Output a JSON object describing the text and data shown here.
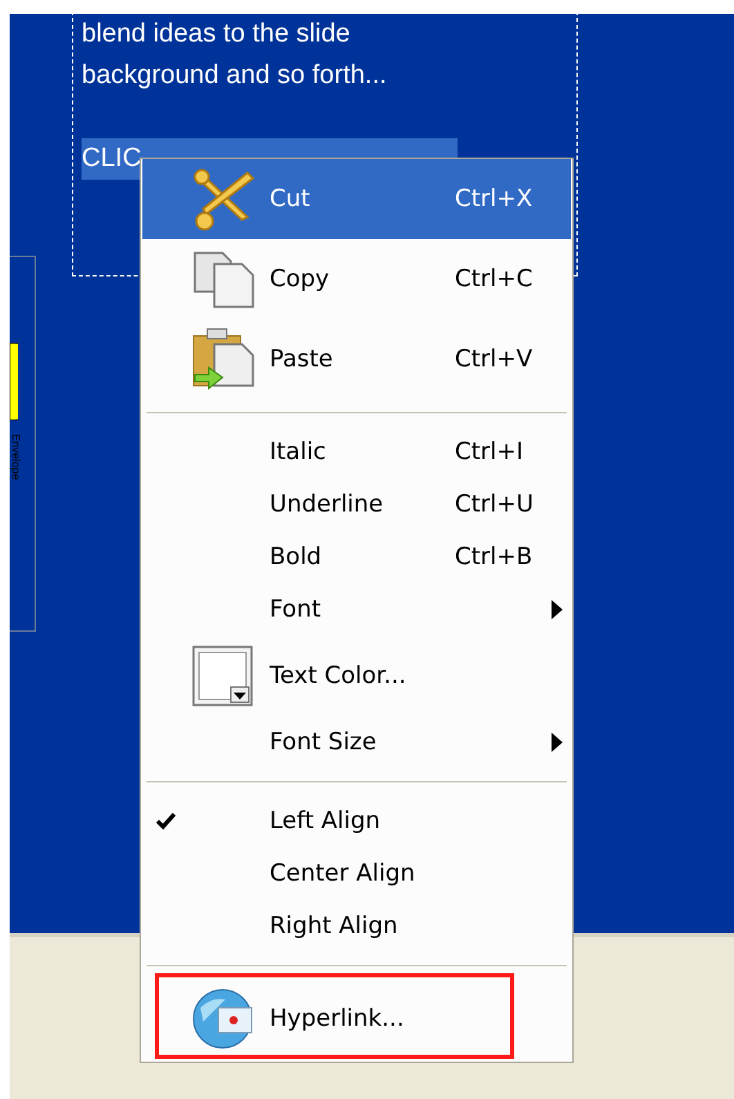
{
  "slide": {
    "text_lines": [
      "blend ideas to the slide",
      "background and so forth..."
    ],
    "selected_text": "CLIC",
    "side_label": "Envelope"
  },
  "context_menu": {
    "items": [
      {
        "kind": "item",
        "label": "Cut",
        "shortcut": "Ctrl+X",
        "selected": true,
        "checked": false,
        "submenu": false,
        "outlined": false
      },
      {
        "kind": "item",
        "label": "Copy",
        "shortcut": "Ctrl+C",
        "selected": false,
        "checked": false,
        "submenu": false,
        "outlined": false
      },
      {
        "kind": "item",
        "label": "Paste",
        "shortcut": "Ctrl+V",
        "selected": false,
        "checked": false,
        "submenu": false,
        "outlined": false
      },
      {
        "kind": "separator"
      },
      {
        "kind": "item",
        "label": "Italic",
        "shortcut": "Ctrl+I",
        "selected": false,
        "checked": false,
        "submenu": false,
        "outlined": false
      },
      {
        "kind": "item",
        "label": "Underline",
        "shortcut": "Ctrl+U",
        "selected": false,
        "checked": false,
        "submenu": false,
        "outlined": false
      },
      {
        "kind": "item",
        "label": "Bold",
        "shortcut": "Ctrl+B",
        "selected": false,
        "checked": false,
        "submenu": false,
        "outlined": false
      },
      {
        "kind": "item",
        "label": "Font",
        "selected": false,
        "checked": false,
        "submenu": true,
        "outlined": false
      },
      {
        "kind": "item",
        "label": "Text Color...",
        "selected": false,
        "checked": false,
        "submenu": false,
        "outlined": false
      },
      {
        "kind": "item",
        "label": "Font Size",
        "selected": false,
        "checked": false,
        "submenu": true,
        "outlined": false
      },
      {
        "kind": "separator"
      },
      {
        "kind": "item",
        "label": "Left Align",
        "selected": false,
        "checked": true,
        "submenu": false,
        "outlined": false
      },
      {
        "kind": "item",
        "label": "Center Align",
        "selected": false,
        "checked": false,
        "submenu": false,
        "outlined": false
      },
      {
        "kind": "item",
        "label": "Right Align",
        "selected": false,
        "checked": false,
        "submenu": false,
        "outlined": false
      },
      {
        "kind": "separator"
      },
      {
        "kind": "item",
        "label": "Hyperlink...",
        "selected": false,
        "checked": false,
        "submenu": false,
        "outlined": true
      }
    ]
  }
}
